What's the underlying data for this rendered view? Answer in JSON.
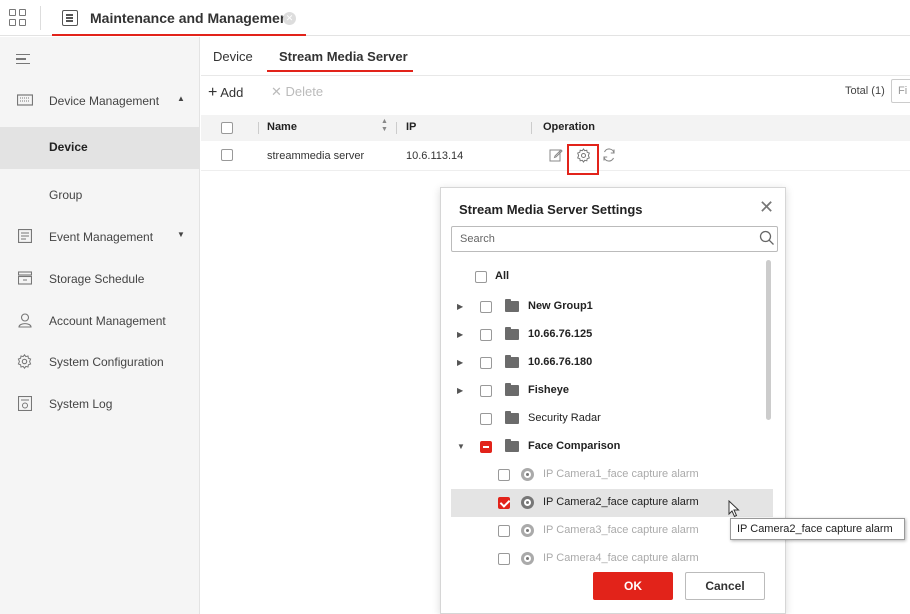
{
  "header": {
    "app_tab_label": "Maintenance and Management"
  },
  "sidebar": {
    "items": [
      {
        "label": "Device Management",
        "icon": "device-management-icon",
        "arrow": "▲"
      },
      {
        "label": "Device",
        "active": true
      },
      {
        "label": "Group"
      },
      {
        "label": "Event Management",
        "icon": "event-management-icon",
        "arrow": "▼"
      },
      {
        "label": "Storage Schedule",
        "icon": "storage-schedule-icon"
      },
      {
        "label": "Account Management",
        "icon": "account-icon"
      },
      {
        "label": "System Configuration",
        "icon": "gear-icon"
      },
      {
        "label": "System Log",
        "icon": "log-icon"
      }
    ]
  },
  "main": {
    "tabs": [
      {
        "label": "Device"
      },
      {
        "label": "Stream Media Server",
        "active": true
      }
    ],
    "toolbar": {
      "add_label": "Add",
      "delete_label": "Delete",
      "total_label": "Total (1)",
      "filter_placeholder": "Fi"
    },
    "table": {
      "columns": [
        "Name",
        "IP",
        "Operation"
      ],
      "rows": [
        {
          "name": "streammedia server",
          "ip": "10.6.113.14"
        }
      ]
    }
  },
  "dialog": {
    "title": "Stream Media Server Settings",
    "search_placeholder": "Search",
    "tree": [
      {
        "label": "All",
        "bold": true,
        "level": 0,
        "type": "all"
      },
      {
        "label": "New Group1",
        "bold": true,
        "level": 1,
        "type": "folder",
        "expandable": true
      },
      {
        "label": "10.66.76.125",
        "bold": true,
        "level": 1,
        "type": "folder",
        "expandable": true
      },
      {
        "label": "10.66.76.180",
        "bold": true,
        "level": 1,
        "type": "folder",
        "expandable": true
      },
      {
        "label": "Fisheye",
        "bold": true,
        "level": 1,
        "type": "folder",
        "expandable": true
      },
      {
        "label": "Security Radar",
        "bold": false,
        "level": 1,
        "type": "folder"
      },
      {
        "label": "Face Comparison",
        "bold": true,
        "level": 1,
        "type": "folder",
        "expanded": true,
        "state": "partial"
      },
      {
        "label": "IP Camera1_face capture alarm",
        "level": 2,
        "type": "camera",
        "dim": true
      },
      {
        "label": "IP Camera2_face capture alarm",
        "level": 2,
        "type": "camera",
        "state": "checked",
        "selected": true
      },
      {
        "label": "IP Camera3_face capture alarm",
        "level": 2,
        "type": "camera",
        "dim": true
      },
      {
        "label": "IP Camera4_face capture alarm",
        "level": 2,
        "type": "camera",
        "dim": true
      }
    ],
    "ok_label": "OK",
    "cancel_label": "Cancel"
  },
  "tooltip": {
    "text": "IP Camera2_face capture alarm"
  },
  "colors": {
    "accent": "#e2231a",
    "sidebar_bg": "#f5f5f5"
  }
}
